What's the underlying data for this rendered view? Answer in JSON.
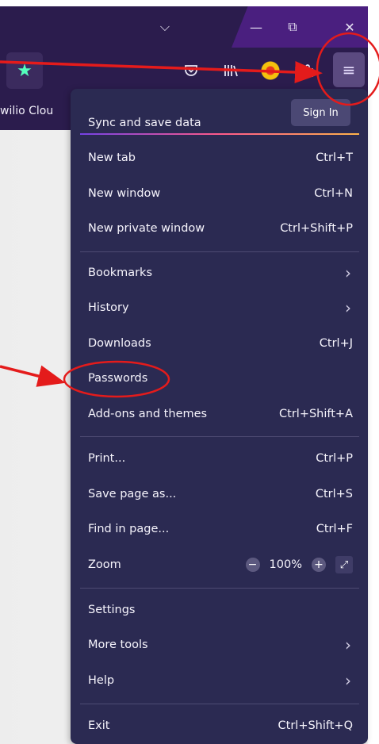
{
  "window": {
    "controls": {
      "dropdown": "⌵",
      "minimize": "—",
      "restore": "⧉",
      "close": "✕"
    }
  },
  "toolbar": {
    "icons": [
      "star-icon",
      "pocket-icon",
      "library-icon",
      "extension-icon",
      "puzzle-icon",
      "hamburger-menu-icon"
    ],
    "menu_button_glyph": "≡"
  },
  "bookmarks": {
    "item": "wilio Clou"
  },
  "menu": {
    "sync_title": "Sync and save data",
    "sign_in": "Sign In",
    "groups": [
      [
        {
          "label": "New tab",
          "shortcut": "Ctrl+T"
        },
        {
          "label": "New window",
          "shortcut": "Ctrl+N"
        },
        {
          "label": "New private window",
          "shortcut": "Ctrl+Shift+P"
        }
      ],
      [
        {
          "label": "Bookmarks",
          "submenu": true
        },
        {
          "label": "History",
          "submenu": true
        },
        {
          "label": "Downloads",
          "shortcut": "Ctrl+J"
        },
        {
          "label": "Passwords"
        },
        {
          "label": "Add-ons and themes",
          "shortcut": "Ctrl+Shift+A"
        }
      ],
      [
        {
          "label": "Print...",
          "shortcut": "Ctrl+P"
        },
        {
          "label": "Save page as...",
          "shortcut": "Ctrl+S"
        },
        {
          "label": "Find in page...",
          "shortcut": "Ctrl+F"
        }
      ],
      [
        {
          "label": "Settings"
        },
        {
          "label": "More tools",
          "submenu": true
        },
        {
          "label": "Help",
          "submenu": true
        }
      ],
      [
        {
          "label": "Exit",
          "shortcut": "Ctrl+Shift+Q"
        }
      ]
    ],
    "zoom": {
      "label": "Zoom",
      "minus": "−",
      "value": "100%",
      "plus": "+",
      "expand": "⤢"
    },
    "chevron": "›"
  },
  "annotation_color": "#e41b1b"
}
